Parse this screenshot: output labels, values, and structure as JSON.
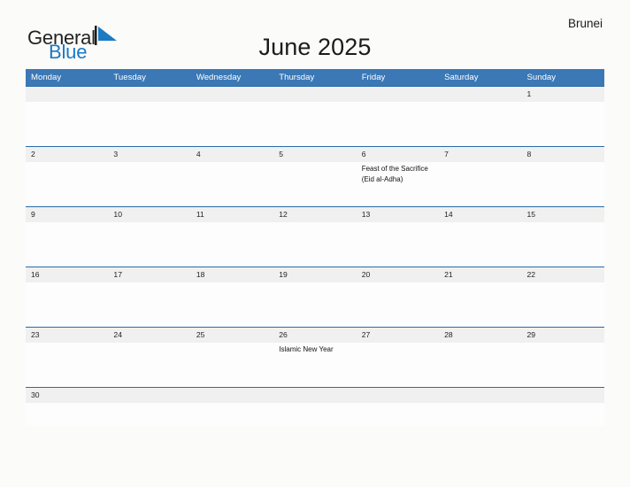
{
  "brand": {
    "name_part1": "General",
    "name_part2": "Blue",
    "flag_icon": "blue-triangle-flag-icon",
    "accent_color": "#1a7ac4"
  },
  "header": {
    "title": "June 2025",
    "country": "Brunei"
  },
  "colors": {
    "weekday_header_bg": "#3b78b5",
    "week_separator": "#2a6ca8",
    "date_strip_bg": "#f0f0f0",
    "page_bg": "#fbfbfa",
    "cell_bg": "#fdfdfd"
  },
  "calendar": {
    "weekdays": [
      "Monday",
      "Tuesday",
      "Wednesday",
      "Thursday",
      "Friday",
      "Saturday",
      "Sunday"
    ],
    "weeks": [
      {
        "dates": [
          "",
          "",
          "",
          "",
          "",
          "",
          "1"
        ],
        "events": [
          "",
          "",
          "",
          "",
          "",
          "",
          ""
        ]
      },
      {
        "dates": [
          "2",
          "3",
          "4",
          "5",
          "6",
          "7",
          "8"
        ],
        "events": [
          "",
          "",
          "",
          "",
          "Feast of the Sacrifice (Eid al-Adha)",
          "",
          ""
        ]
      },
      {
        "dates": [
          "9",
          "10",
          "11",
          "12",
          "13",
          "14",
          "15"
        ],
        "events": [
          "",
          "",
          "",
          "",
          "",
          "",
          ""
        ]
      },
      {
        "dates": [
          "16",
          "17",
          "18",
          "19",
          "20",
          "21",
          "22"
        ],
        "events": [
          "",
          "",
          "",
          "",
          "",
          "",
          ""
        ]
      },
      {
        "dates": [
          "23",
          "24",
          "25",
          "26",
          "27",
          "28",
          "29"
        ],
        "events": [
          "",
          "",
          "",
          "Islamic New Year",
          "",
          "",
          ""
        ]
      },
      {
        "dates": [
          "30",
          "",
          "",
          "",
          "",
          "",
          ""
        ],
        "events": [
          "",
          "",
          "",
          "",
          "",
          "",
          ""
        ]
      }
    ]
  }
}
